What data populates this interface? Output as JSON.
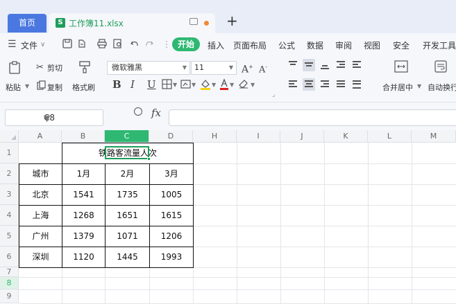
{
  "tabs": {
    "home": "首页",
    "doc_icon": "S",
    "doc_title": "工作簿11.xlsx",
    "add": "+"
  },
  "menu": {
    "hamburger": "☰",
    "file": "文件",
    "file_chevron": "∨",
    "start": "开始",
    "items": [
      "插入",
      "页面布局",
      "公式",
      "数据",
      "审阅",
      "视图",
      "安全",
      "开发工具"
    ]
  },
  "ribbon": {
    "paste": "粘贴",
    "cut": "剪切",
    "copy": "复制",
    "format_painter": "格式刷",
    "font_name": "微软雅黑",
    "font_size": "11",
    "bold": "B",
    "italic": "I",
    "underline": "U",
    "merge_center": "合并居中",
    "auto_wrap": "自动换行"
  },
  "formula_bar": {
    "cell_ref": "C8",
    "fx": "fx",
    "formula": ""
  },
  "grid": {
    "columns": [
      "A",
      "B",
      "C",
      "D",
      "H",
      "I",
      "J",
      "K",
      "L",
      "M"
    ],
    "rows": [
      "1",
      "2",
      "3",
      "4",
      "5",
      "6",
      "7",
      "8",
      "9"
    ],
    "selected_column": "C",
    "selected_row": "8"
  },
  "table": {
    "title": "铁路客流量人次",
    "header": [
      "城市",
      "1月",
      "2月",
      "3月"
    ],
    "rows": [
      [
        "北京",
        "1541",
        "1735",
        "1005"
      ],
      [
        "上海",
        "1268",
        "1651",
        "1615"
      ],
      [
        "广州",
        "1379",
        "1071",
        "1206"
      ],
      [
        "深圳",
        "1120",
        "1445",
        "1993"
      ]
    ]
  },
  "colors": {
    "accent_green": "#2eb872",
    "home_tab_blue": "#4a78e0",
    "unsaved_dot": "#f28a30"
  }
}
